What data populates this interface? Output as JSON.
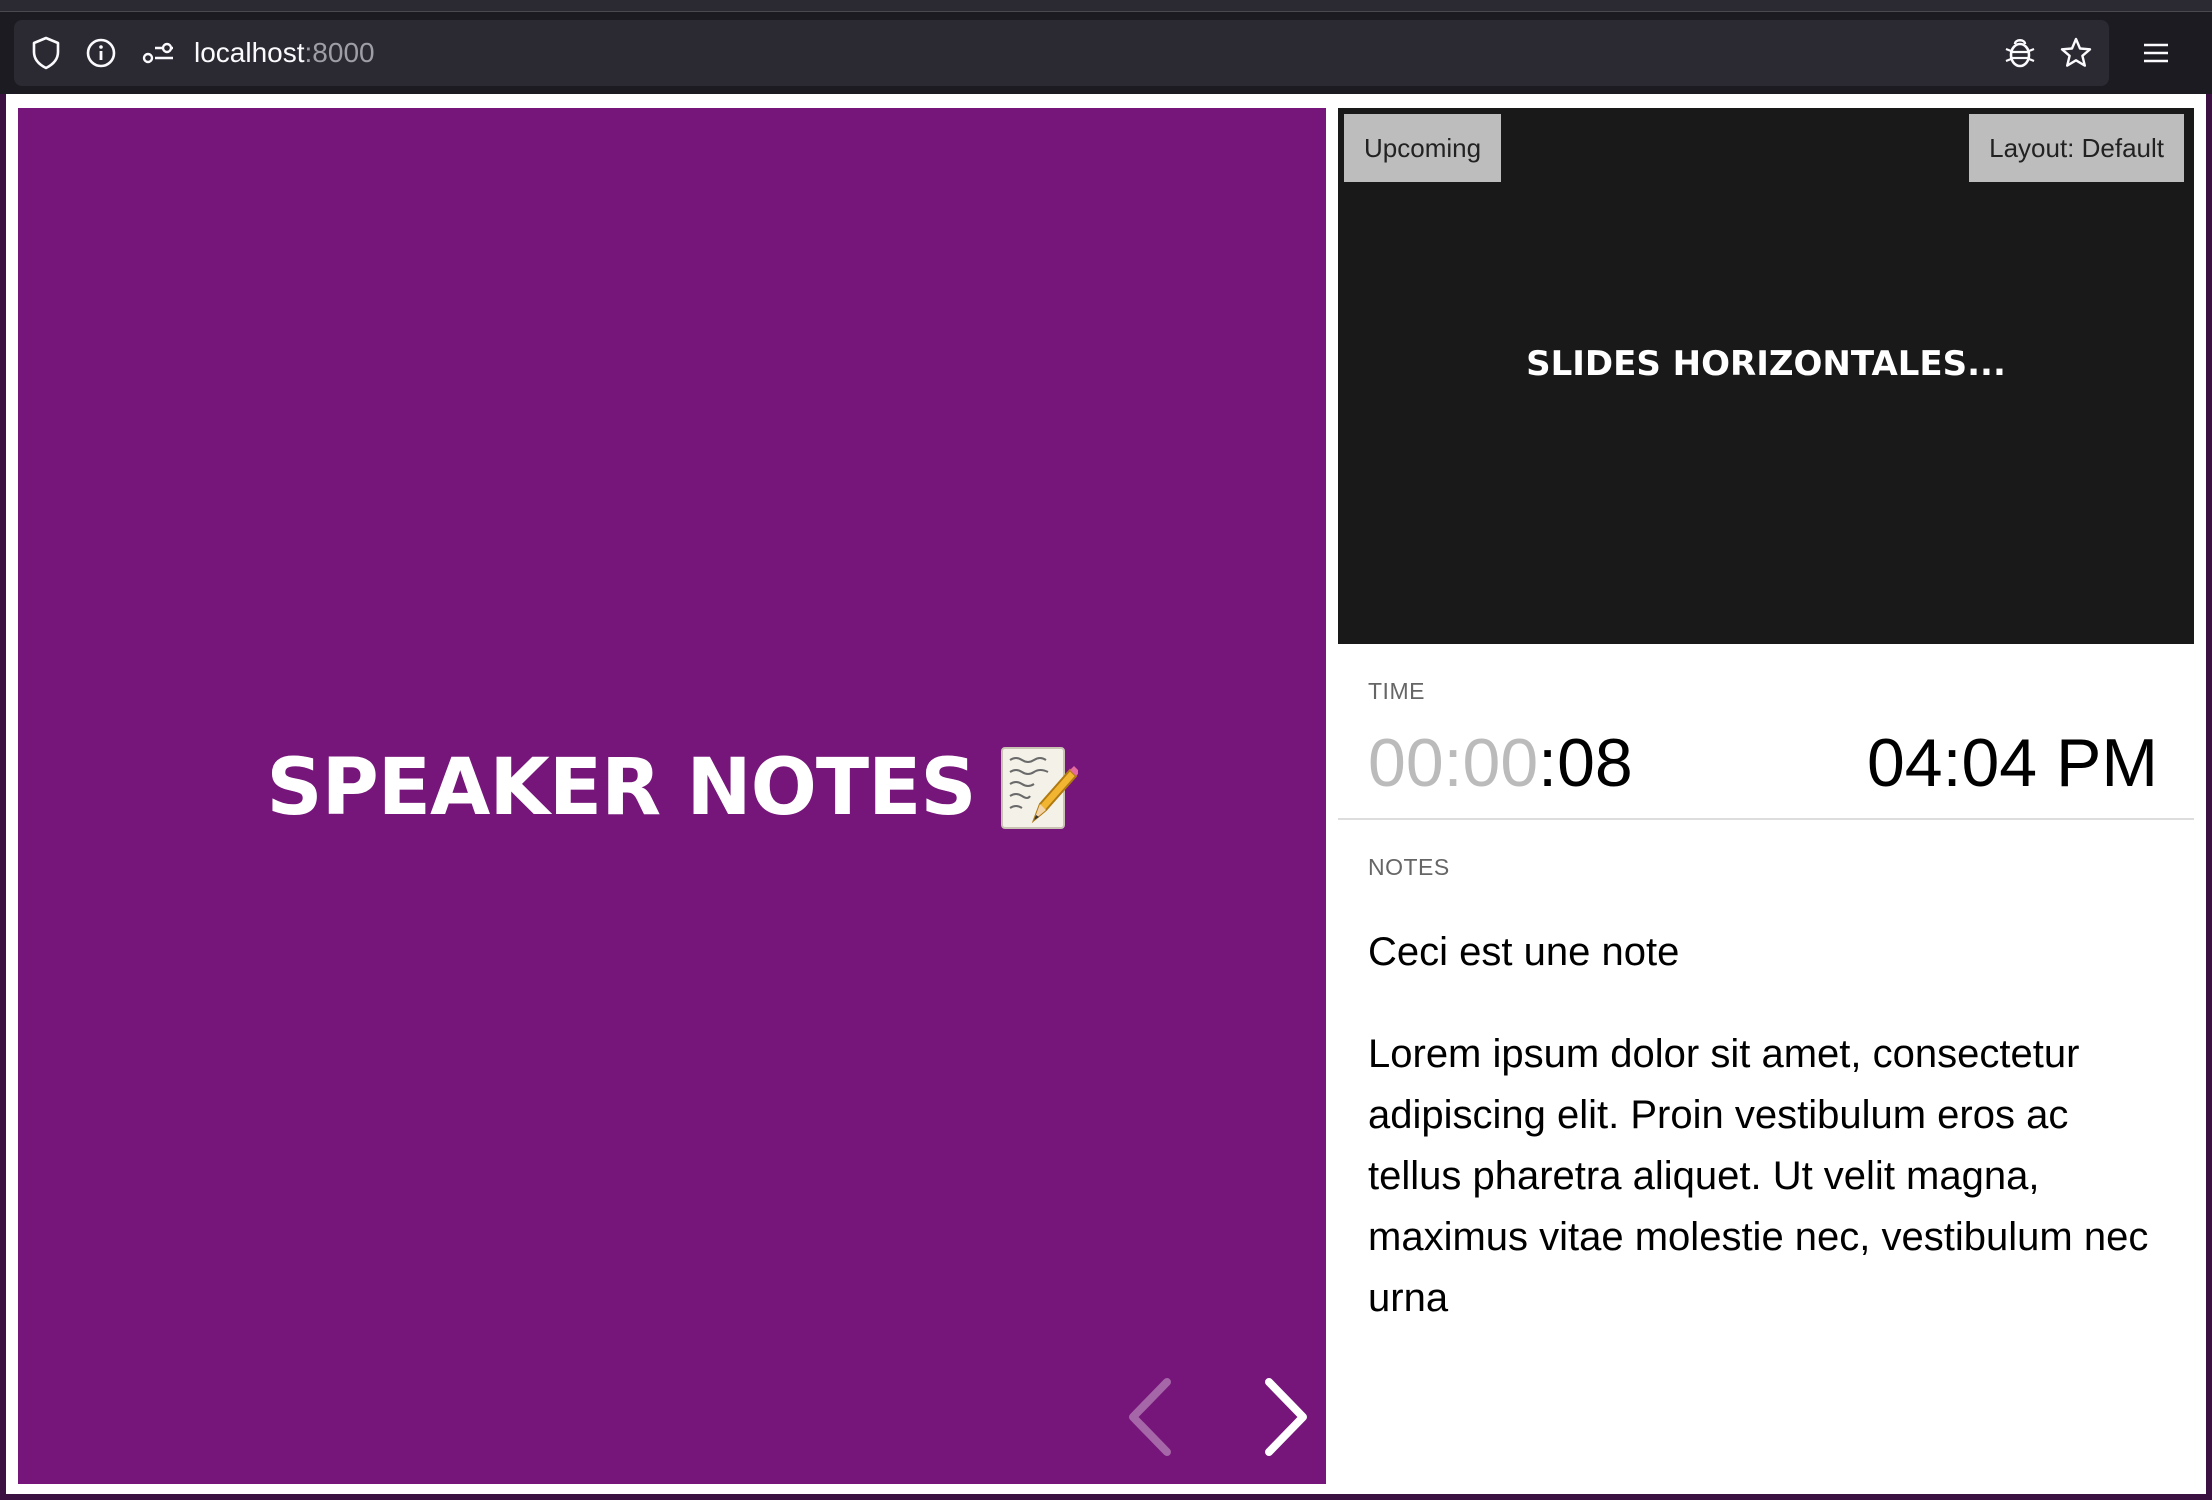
{
  "browser": {
    "url_host": "localhost",
    "url_port": ":8000"
  },
  "current_slide": {
    "heading": "SPEAKER NOTES",
    "emoji_icon": "memo-icon",
    "background": "#76157a"
  },
  "upcoming": {
    "label": "Upcoming",
    "layout_label": "Layout: Default",
    "title": "SLIDES HORIZONTALES..."
  },
  "time": {
    "label": "TIME",
    "timer_dim": "00:00",
    "timer_active": ":08",
    "clock": "04:04 PM"
  },
  "notes": {
    "label": "NOTES",
    "paragraphs": [
      "Ceci est une note",
      "Lorem ipsum dolor sit amet, consectetur adipiscing elit. Proin vestibulum eros ac tellus pharetra aliquet. Ut velit magna, maximus vitae molestie nec, vestibulum nec urna"
    ]
  }
}
